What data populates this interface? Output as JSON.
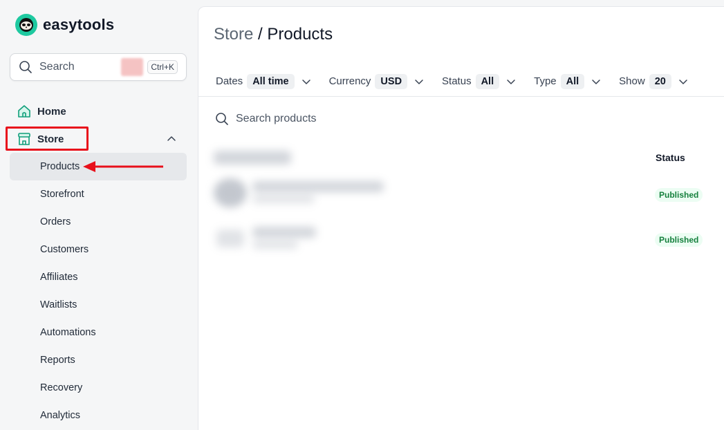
{
  "app": {
    "name": "easytools"
  },
  "sidebar": {
    "search_label": "Search",
    "search_shortcut": "Ctrl+K",
    "home_label": "Home",
    "store_label": "Store",
    "sub_items": [
      "Products",
      "Storefront",
      "Orders",
      "Customers",
      "Affiliates",
      "Waitlists",
      "Automations",
      "Reports",
      "Recovery",
      "Analytics"
    ]
  },
  "page": {
    "breadcrumb_parent": "Store",
    "breadcrumb_sep": " / ",
    "breadcrumb_current": "Products"
  },
  "filters": [
    {
      "label": "Dates",
      "value": "All time"
    },
    {
      "label": "Currency",
      "value": "USD"
    },
    {
      "label": "Status",
      "value": "All"
    },
    {
      "label": "Type",
      "value": "All"
    },
    {
      "label": "Show",
      "value": "20"
    }
  ],
  "product_search": {
    "placeholder": "Search products"
  },
  "table": {
    "status_header": "Status",
    "rows": [
      {
        "status": "Published"
      },
      {
        "status": "Published"
      }
    ]
  },
  "colors": {
    "brand": "#1ec9a0",
    "annotation": "#e8101b",
    "published_text": "#15803d"
  }
}
